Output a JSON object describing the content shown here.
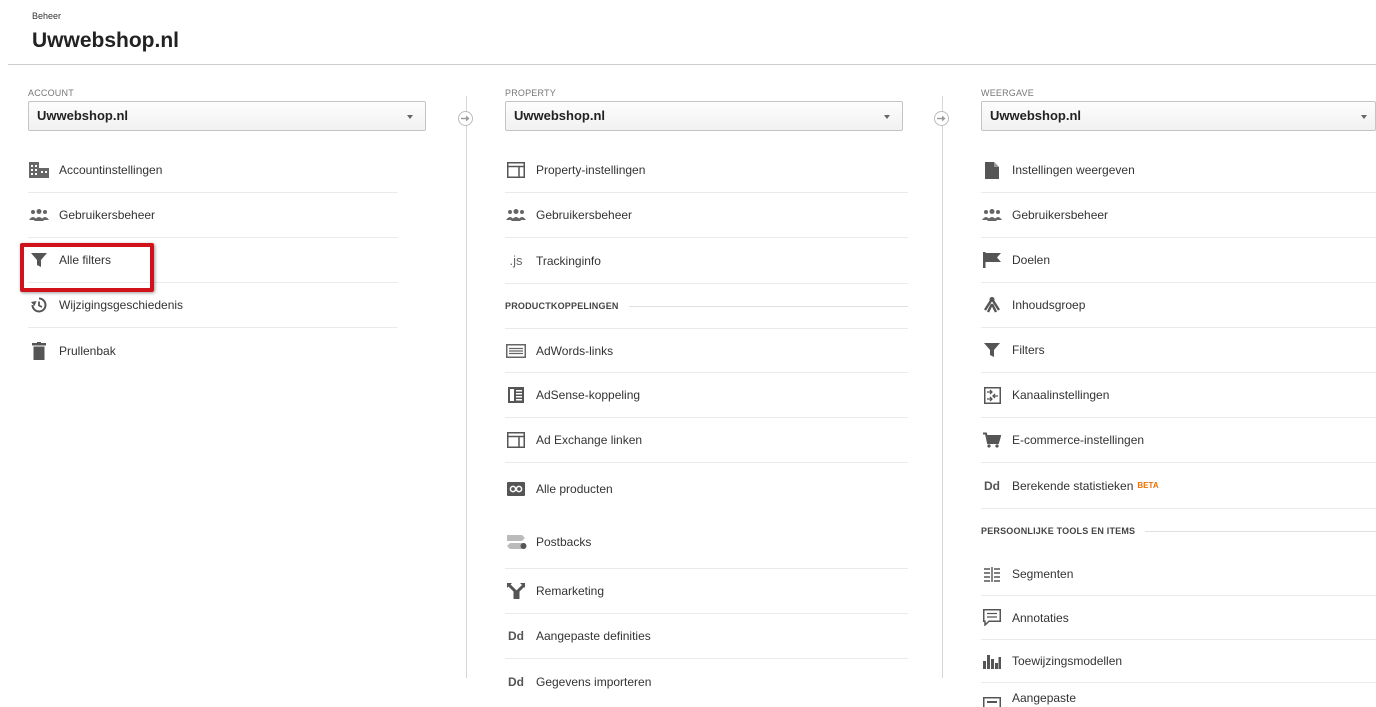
{
  "breadcrumb": "Beheer",
  "title": "Uwwebshop.nl",
  "account": {
    "label": "ACCOUNT",
    "selected": "Uwwebshop.nl",
    "items": [
      {
        "icon": "building-icon",
        "label": "Accountinstellingen"
      },
      {
        "icon": "users-icon",
        "label": "Gebruikersbeheer"
      },
      {
        "icon": "filter-icon",
        "label": "Alle filters"
      },
      {
        "icon": "history-icon",
        "label": "Wijzigingsgeschiedenis"
      },
      {
        "icon": "trash-icon",
        "label": "Prullenbak"
      }
    ]
  },
  "property": {
    "label": "PROPERTY",
    "selected": "Uwwebshop.nl",
    "items": [
      {
        "icon": "window-icon",
        "label": "Property-instellingen"
      },
      {
        "icon": "users-icon",
        "label": "Gebruikersbeheer"
      },
      {
        "icon": "js-icon",
        "label": "Trackinginfo",
        "glyph": ".js"
      }
    ],
    "section": "PRODUCTKOPPELINGEN",
    "links": [
      {
        "icon": "adwords-icon",
        "label": "AdWords-links"
      },
      {
        "icon": "adsense-icon",
        "label": "AdSense-koppeling"
      },
      {
        "icon": "window-icon",
        "label": "Ad Exchange linken"
      },
      {
        "icon": "link-icon",
        "label": "Alle producten"
      }
    ],
    "more": [
      {
        "icon": "postbacks-icon",
        "label": "Postbacks"
      },
      {
        "icon": "remarketing-icon",
        "label": "Remarketing"
      },
      {
        "icon": "dd-icon",
        "label": "Aangepaste definities",
        "glyph": "Dd"
      },
      {
        "icon": "dd-icon",
        "label": "Gegevens importeren",
        "glyph": "Dd"
      }
    ]
  },
  "view": {
    "label": "WEERGAVE",
    "selected": "Uwwebshop.nl",
    "items": [
      {
        "icon": "document-icon",
        "label": "Instellingen weergeven"
      },
      {
        "icon": "users-icon",
        "label": "Gebruikersbeheer"
      },
      {
        "icon": "flag-icon",
        "label": "Doelen"
      },
      {
        "icon": "content-group-icon",
        "label": "Inhoudsgroep"
      },
      {
        "icon": "filter-icon",
        "label": "Filters"
      },
      {
        "icon": "channel-icon",
        "label": "Kanaalinstellingen"
      },
      {
        "icon": "cart-icon",
        "label": "E-commerce-instellingen"
      },
      {
        "icon": "dd-icon",
        "label": "Berekende statistieken",
        "glyph": "Dd",
        "badge": "BETA"
      }
    ],
    "section": "PERSOONLIJKE TOOLS EN ITEMS",
    "tools": [
      {
        "icon": "segments-icon",
        "label": "Segmenten"
      },
      {
        "icon": "annotation-icon",
        "label": "Annotaties"
      },
      {
        "icon": "attribution-icon",
        "label": "Toewijzingsmodellen"
      },
      {
        "icon": "custom-icon",
        "label": "Aangepaste"
      }
    ]
  },
  "colors": {
    "highlight": "#d0121b",
    "beta": "#e8710a",
    "icon": "#555555"
  }
}
